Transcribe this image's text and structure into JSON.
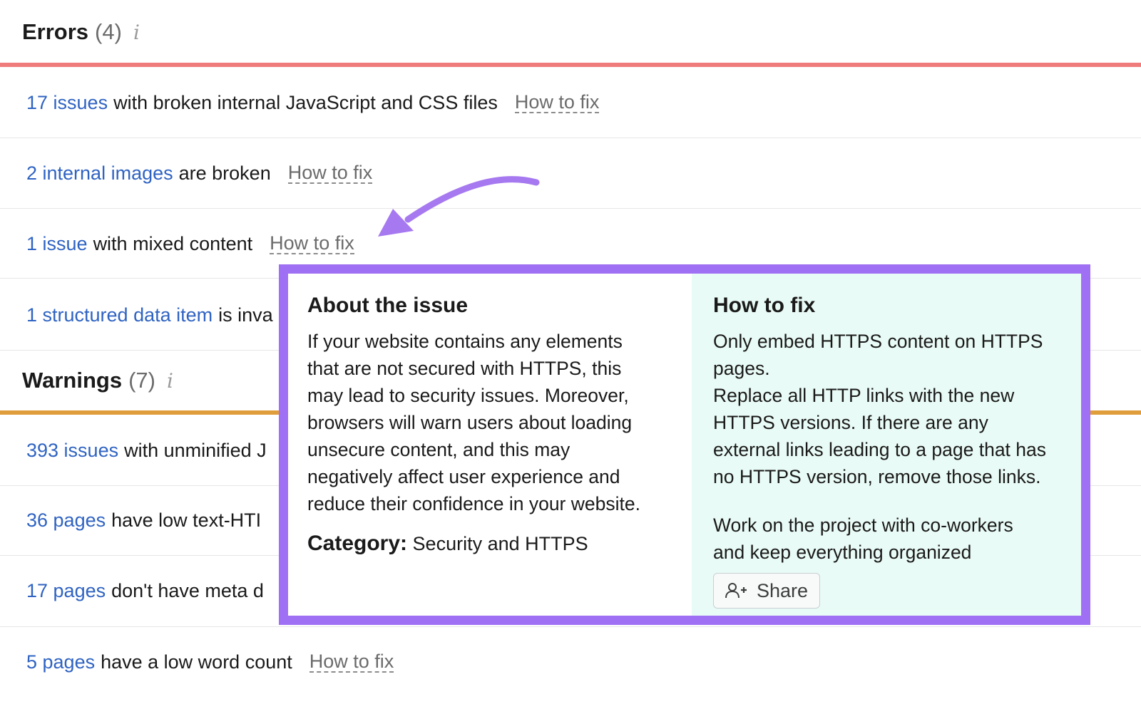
{
  "errors": {
    "title": "Errors",
    "count": "(4)",
    "info_glyph": "i",
    "accent_color": "#ef7b7b",
    "rows": [
      {
        "count_link": "17 issues",
        "text": "with broken internal JavaScript and CSS files",
        "fix": "How to fix"
      },
      {
        "count_link": "2 internal images",
        "text": "are broken",
        "fix": "How to fix"
      },
      {
        "count_link": "1 issue",
        "text": "with mixed content",
        "fix": "How to fix"
      },
      {
        "count_link": "1 structured data item",
        "text": "is inva"
      }
    ]
  },
  "warnings": {
    "title": "Warnings",
    "count": "(7)",
    "info_glyph": "i",
    "accent_color": "#e09d3c",
    "rows": [
      {
        "count_link": "393 issues",
        "text": "with unminified J"
      },
      {
        "count_link": "36 pages",
        "text": "have low text-HTI"
      },
      {
        "count_link": "17 pages",
        "text": "don't have meta d"
      },
      {
        "count_link": "5 pages",
        "text": "have a low word count",
        "fix": "How to fix"
      }
    ]
  },
  "popup": {
    "border_color": "#a070f4",
    "about_title": "About the issue",
    "about_text": "If your website contains any elements\nthat are not secured with HTTPS, this\nmay lead to security issues. Moreover,\nbrowsers will warn users about loading\nunsecure content, and this may\nnegatively affect user experience and\nreduce their confidence in your website.",
    "category_label": "Category:",
    "category_value": "Security and HTTPS",
    "fix_title": "How to fix",
    "fix_text": "Only embed HTTPS content on HTTPS\npages.\nReplace all HTTP links with the new\nHTTPS versions. If there are any\nexternal links leading to a page that has\nno HTTPS version, remove those links.",
    "cowork_text": "Work on the project with co-workers\nand keep everything organized",
    "share_label": "Share",
    "share_icon": "add-user-icon"
  },
  "annotation": {
    "arrow_color": "#a679f0"
  }
}
